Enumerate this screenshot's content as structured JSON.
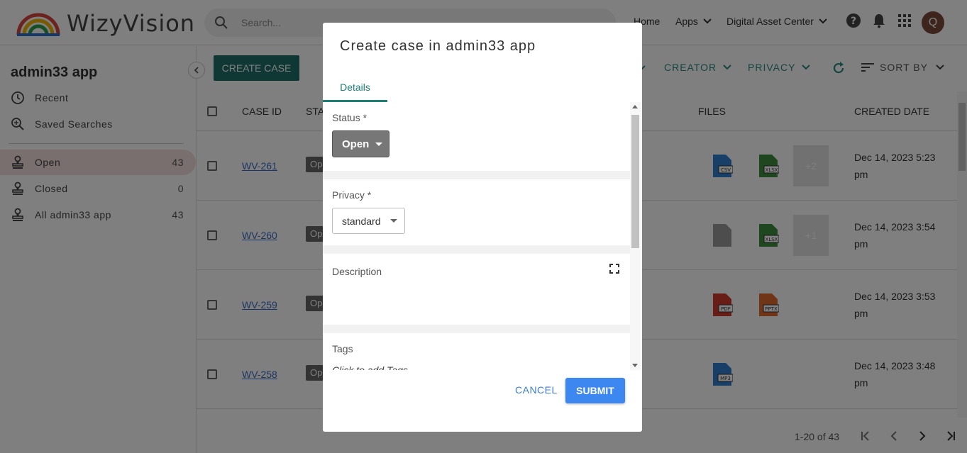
{
  "header": {
    "logo_text": "WizyVision",
    "search_placeholder": "Search...",
    "nav_home": "Home",
    "nav_apps": "Apps",
    "nav_dac": "Digital Asset Center",
    "avatar_initial": "Q"
  },
  "sidebar": {
    "app_title": "admin33 app",
    "recent": "Recent",
    "saved_searches": "Saved Searches",
    "items": [
      {
        "label": "Open",
        "count": "43"
      },
      {
        "label": "Closed",
        "count": "0"
      },
      {
        "label": "All admin33 app",
        "count": "43"
      }
    ]
  },
  "toolbar": {
    "create_case": "CREATE CASE",
    "creator": "CREATOR",
    "privacy": "PRIVACY",
    "sort_by": "SORT BY"
  },
  "table": {
    "headers": {
      "case_id": "CASE ID",
      "status": "STA",
      "files": "FILES",
      "created_date": "CREATED DATE"
    },
    "rows": [
      {
        "case_id": "WV-261",
        "status": "Op",
        "date_line1": "Dec 14, 2023 5:23",
        "date_line2": "pm",
        "files": [
          "CSV",
          "XLSX"
        ],
        "more": "+2"
      },
      {
        "case_id": "WV-260",
        "status": "Op",
        "date_line1": "Dec 14, 2023 3:54",
        "date_line2": "pm",
        "files": [
          "",
          "XLSX"
        ],
        "more": "+1"
      },
      {
        "case_id": "WV-259",
        "status": "Op",
        "date_line1": "Dec 14, 2023 3:53",
        "date_line2": "pm",
        "files": [
          "PDF",
          "PPTX"
        ],
        "more": ""
      },
      {
        "case_id": "WV-258",
        "status": "Op",
        "date_line1": "Dec 14, 2023 3:48",
        "date_line2": "pm",
        "files": [
          "MP3"
        ],
        "more": ""
      }
    ]
  },
  "pagination": {
    "range": "1-20 of 43"
  },
  "dialog": {
    "title": "Create case in admin33 app",
    "tab_details": "Details",
    "status_label": "Status *",
    "status_value": "Open",
    "privacy_label": "Privacy *",
    "privacy_value": "standard",
    "description_label": "Description",
    "tags_label": "Tags",
    "tags_placeholder": "Click to add Tags",
    "cancel": "CANCEL",
    "submit": "SUBMIT"
  },
  "colors": {
    "primary_teal": "#1e6f66",
    "link_blue": "#3a6bc6",
    "submit_blue": "#3d87f0",
    "csv": "#2f7fd1",
    "xlsx": "#3f8f3f",
    "pdf": "#d23b2f",
    "pptx": "#e06a2c",
    "mp3": "#2f7fd1",
    "generic_file": "#9a9a9a"
  }
}
